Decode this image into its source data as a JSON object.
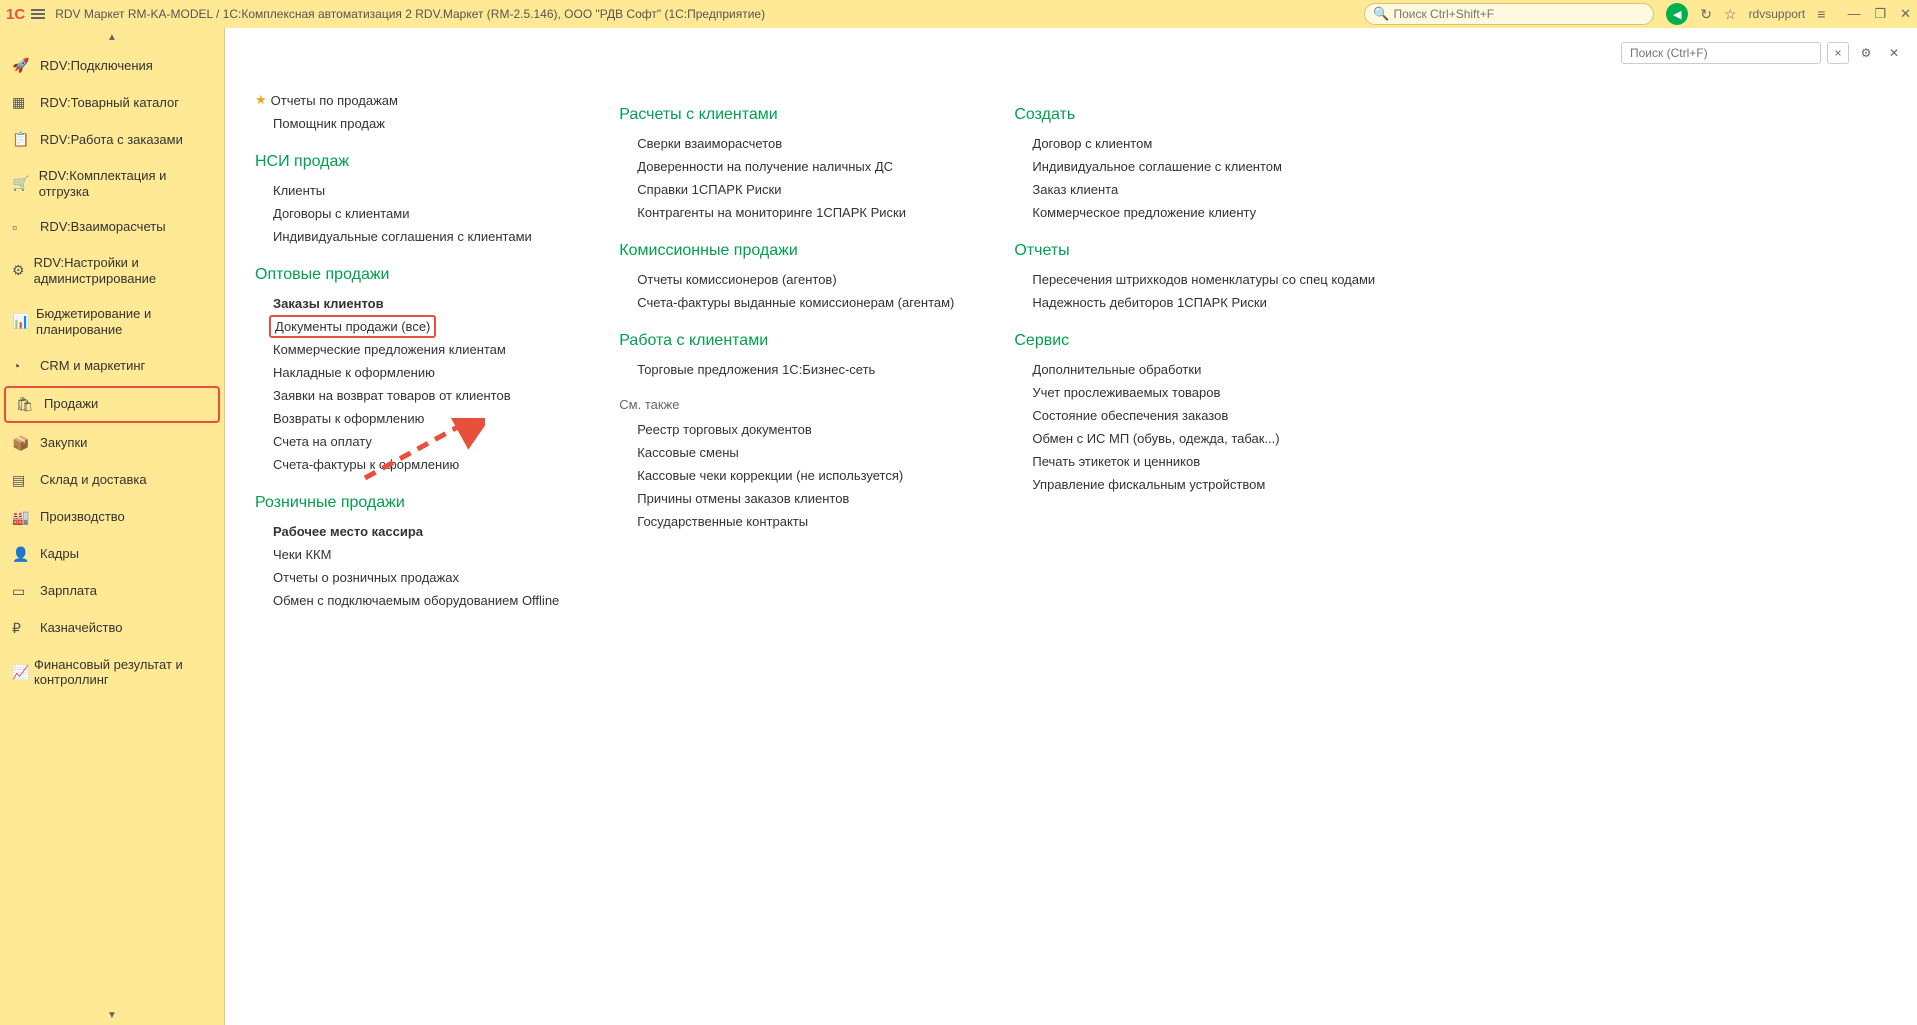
{
  "header": {
    "logo": "1C",
    "title": "RDV Маркет RM-KA-MODEL / 1С:Комплексная автоматизация 2 RDV.Маркет (RM-2.5.146), ООО \"РДВ Софт\"  (1С:Предприятие)",
    "search_placeholder": "Поиск Ctrl+Shift+F",
    "username": "rdvsupport"
  },
  "sidebar": {
    "items": [
      {
        "label": "RDV:Подключения",
        "icon": "🚀"
      },
      {
        "label": "RDV:Товарный каталог",
        "icon": "▦"
      },
      {
        "label": "RDV:Работа с заказами",
        "icon": "📋"
      },
      {
        "label": "RDV:Комплектация и отгрузка",
        "icon": "🛒"
      },
      {
        "label": "RDV:Взаиморасчеты",
        "icon": "▫"
      },
      {
        "label": "RDV:Настройки и администрирование",
        "icon": "⚙"
      },
      {
        "label": "Бюджетирование и планирование",
        "icon": "📊"
      },
      {
        "label": "CRM и маркетинг",
        "icon": "◔"
      },
      {
        "label": "Продажи",
        "icon": "🛍",
        "highlighted": true
      },
      {
        "label": "Закупки",
        "icon": "📦"
      },
      {
        "label": "Склад и доставка",
        "icon": "▤"
      },
      {
        "label": "Производство",
        "icon": "🏭"
      },
      {
        "label": "Кадры",
        "icon": "👤"
      },
      {
        "label": "Зарплата",
        "icon": "▭"
      },
      {
        "label": "Казначейство",
        "icon": "₽"
      },
      {
        "label": "Финансовый результат и контроллинг",
        "icon": "📈"
      }
    ]
  },
  "content": {
    "search_placeholder": "Поиск (Ctrl+F)",
    "col1": {
      "star_link": "Отчеты по продажам",
      "helper": "Помощник продаж",
      "sections": [
        {
          "title": "НСИ продаж",
          "items": [
            {
              "label": "Клиенты"
            },
            {
              "label": "Договоры с клиентами"
            },
            {
              "label": "Индивидуальные соглашения с клиентами"
            }
          ]
        },
        {
          "title": "Оптовые продажи",
          "items": [
            {
              "label": "Заказы клиентов",
              "bold": true
            },
            {
              "label": "Документы продажи (все)",
              "highlighted": true
            },
            {
              "label": "Коммерческие предложения клиентам"
            },
            {
              "label": "Накладные к оформлению"
            },
            {
              "label": "Заявки на возврат товаров от клиентов"
            },
            {
              "label": "Возвраты к оформлению"
            },
            {
              "label": "Счета на оплату"
            },
            {
              "label": "Счета-фактуры к оформлению"
            }
          ]
        },
        {
          "title": "Розничные продажи",
          "items": [
            {
              "label": "Рабочее место кассира",
              "bold": true
            },
            {
              "label": "Чеки ККМ"
            },
            {
              "label": "Отчеты о розничных продажах"
            },
            {
              "label": "Обмен с подключаемым оборудованием Offline"
            }
          ]
        }
      ]
    },
    "col2": {
      "sections": [
        {
          "title": "Расчеты с клиентами",
          "items": [
            {
              "label": "Сверки взаиморасчетов"
            },
            {
              "label": "Доверенности на получение наличных ДС"
            },
            {
              "label": "Справки 1СПАРК Риски"
            },
            {
              "label": "Контрагенты на мониторинге 1СПАРК Риски"
            }
          ]
        },
        {
          "title": "Комиссионные продажи",
          "items": [
            {
              "label": "Отчеты комиссионеров (агентов)"
            },
            {
              "label": "Счета-фактуры выданные комиссионерам (агентам)"
            }
          ]
        },
        {
          "title": "Работа с клиентами",
          "items": [
            {
              "label": "Торговые предложения 1С:Бизнес-сеть"
            }
          ]
        }
      ],
      "see_also": "См. также",
      "see_also_items": [
        {
          "label": "Реестр торговых документов"
        },
        {
          "label": "Кассовые смены"
        },
        {
          "label": "Кассовые чеки коррекции (не используется)"
        },
        {
          "label": "Причины отмены заказов клиентов"
        },
        {
          "label": "Государственные контракты"
        }
      ]
    },
    "col3": {
      "sections": [
        {
          "title": "Создать",
          "items": [
            {
              "label": "Договор с клиентом"
            },
            {
              "label": "Индивидуальное соглашение с клиентом"
            },
            {
              "label": "Заказ клиента"
            },
            {
              "label": "Коммерческое предложение клиенту"
            }
          ]
        },
        {
          "title": "Отчеты",
          "items": [
            {
              "label": "Пересечения штрихкодов номенклатуры со спец кодами"
            },
            {
              "label": "Надежность дебиторов 1СПАРК Риски"
            }
          ]
        },
        {
          "title": "Сервис",
          "items": [
            {
              "label": "Дополнительные обработки"
            },
            {
              "label": "Учет прослеживаемых товаров"
            },
            {
              "label": "Состояние обеспечения заказов"
            },
            {
              "label": "Обмен с ИС МП (обувь, одежда, табак...)"
            },
            {
              "label": "Печать этикеток и ценников"
            },
            {
              "label": "Управление фискальным устройством"
            }
          ]
        }
      ]
    }
  }
}
